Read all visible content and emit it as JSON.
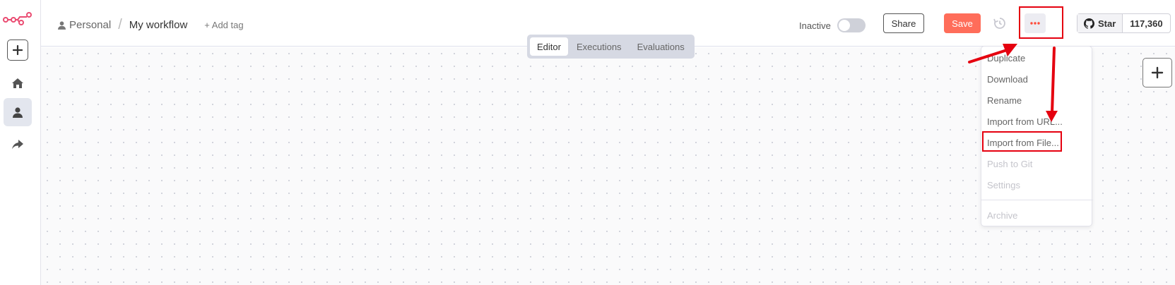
{
  "sidebar": {
    "logo_icon": "n8n-logo-icon",
    "add_icon": "plus-icon",
    "items": [
      {
        "name": "home",
        "icon": "home-icon"
      },
      {
        "name": "personal",
        "icon": "user-icon",
        "active": true
      },
      {
        "name": "shared",
        "icon": "share-arrow-icon"
      }
    ]
  },
  "header": {
    "breadcrumb": {
      "project": "Personal",
      "separator": "/",
      "workflow": "My workflow"
    },
    "add_tag": "+ Add tag",
    "tabs": [
      {
        "label": "Editor",
        "active": true
      },
      {
        "label": "Executions"
      },
      {
        "label": "Evaluations"
      }
    ],
    "status_label": "Inactive",
    "active": false,
    "share_label": "Share",
    "save_label": "Save",
    "github": {
      "star_label": "Star",
      "count": "117,360"
    }
  },
  "menu": {
    "items": [
      {
        "label": "Duplicate",
        "enabled": true
      },
      {
        "label": "Download",
        "enabled": true
      },
      {
        "label": "Rename",
        "enabled": true
      },
      {
        "label": "Import from URL...",
        "enabled": true
      },
      {
        "label": "Import from File...",
        "enabled": true,
        "highlighted": true
      },
      {
        "label": "Push to Git",
        "enabled": false
      },
      {
        "label": "Settings",
        "enabled": false
      },
      {
        "label": "Archive",
        "enabled": false
      }
    ]
  },
  "colors": {
    "accent": "#ff6d5a",
    "brand_logo": "#ea4b71",
    "annotation": "#e5000f",
    "tab_bar": "#d6d9e3",
    "active_nav_bg": "#e3e6ee"
  }
}
